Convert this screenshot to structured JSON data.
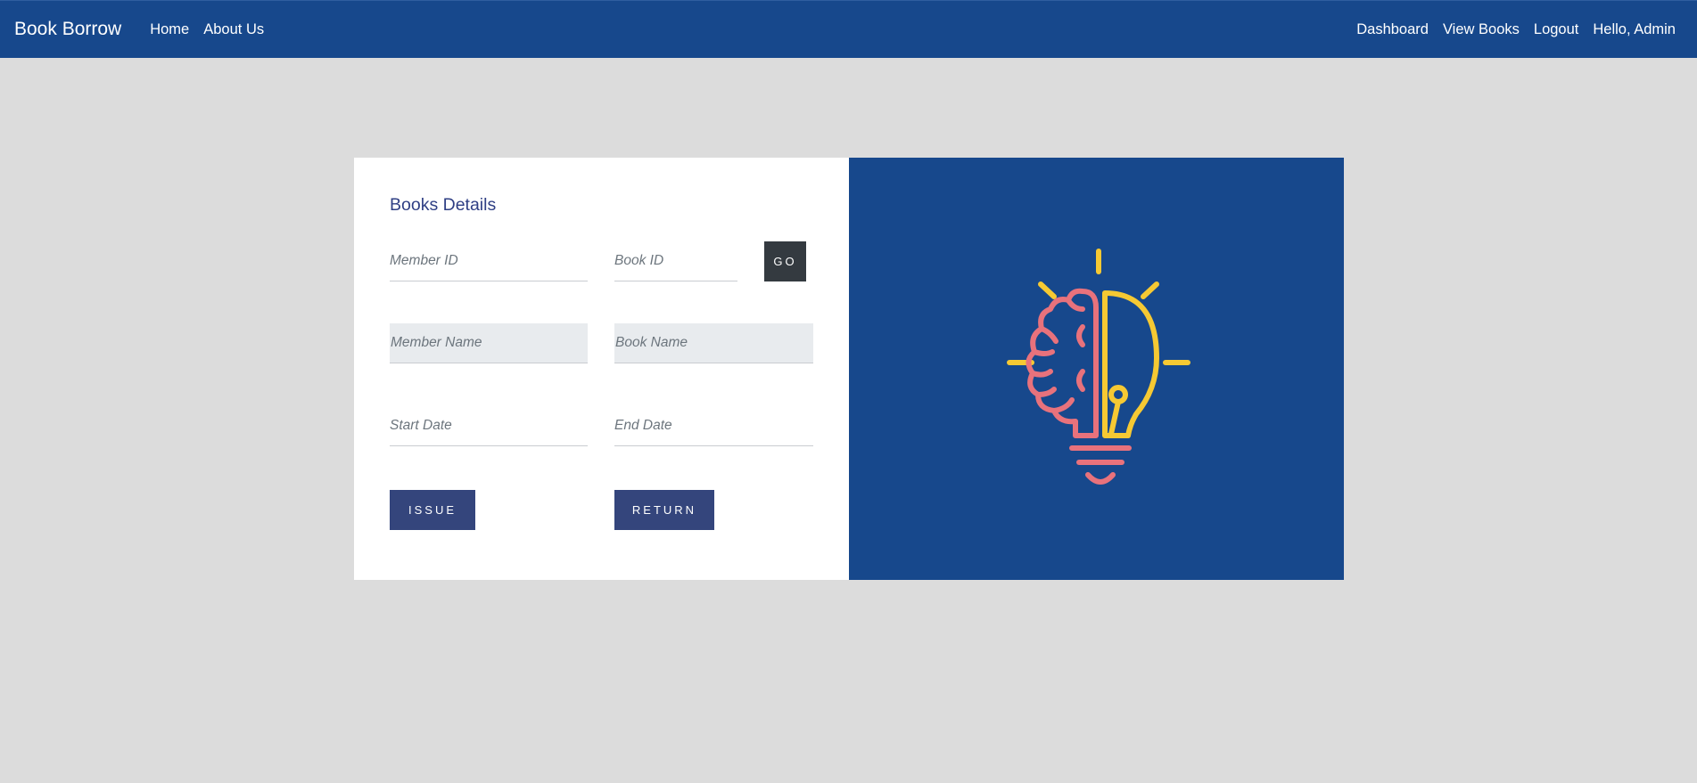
{
  "navbar": {
    "brand": "Book Borrow",
    "left_links": [
      "Home",
      "About Us"
    ],
    "right_links": [
      "Dashboard",
      "View Books",
      "Logout"
    ],
    "greeting": "Hello, Admin"
  },
  "form": {
    "title": "Books Details",
    "member_id_placeholder": "Member ID",
    "book_id_placeholder": "Book ID",
    "go_label": "GO",
    "member_name_placeholder": "Member Name",
    "book_name_placeholder": "Book Name",
    "start_date_placeholder": "Start Date",
    "end_date_placeholder": "End Date",
    "issue_label": "ISSUE",
    "return_label": "RETURN"
  },
  "illustration": {
    "icon": "brain-lightbulb-icon",
    "brain_color": "#e8727c",
    "bulb_color": "#f6c933",
    "background_color": "#17488c"
  }
}
